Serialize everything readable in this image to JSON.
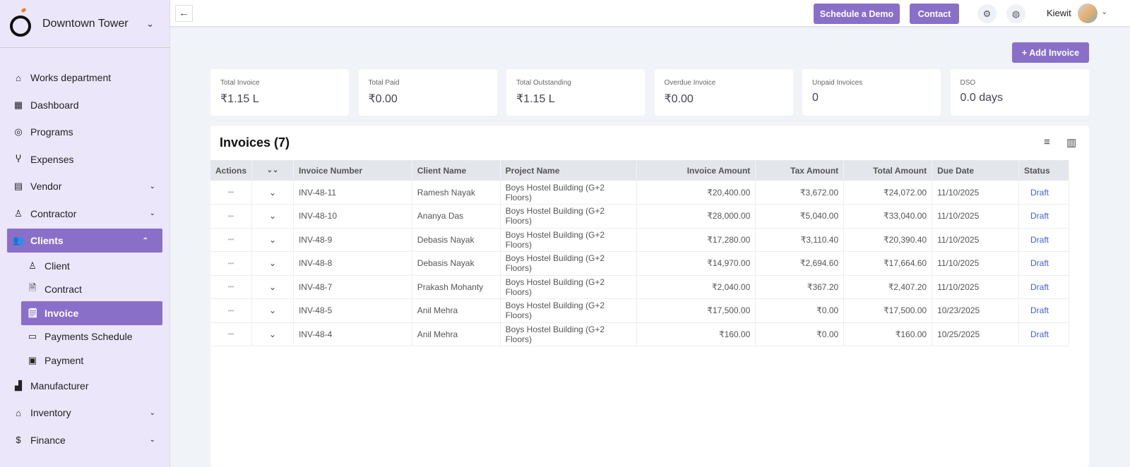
{
  "sidebar": {
    "project": "Downtown Tower",
    "items": [
      {
        "label": "Works department",
        "icon": "home-icon",
        "glyph": "⌂"
      },
      {
        "label": "Dashboard",
        "icon": "dashboard-icon",
        "glyph": "▦"
      },
      {
        "label": "Programs",
        "icon": "programs-icon",
        "glyph": "◎"
      },
      {
        "label": "Expenses",
        "icon": "expenses-icon",
        "glyph": "Ⴤ"
      },
      {
        "label": "Vendor",
        "icon": "vendor-icon",
        "glyph": "▤",
        "chev": "⌄"
      },
      {
        "label": "Contractor",
        "icon": "contractor-icon",
        "glyph": "♙",
        "chev": "⌄"
      },
      {
        "label": "Clients",
        "icon": "users-icon",
        "glyph": "👥",
        "chev": "⌃",
        "active": true,
        "children": [
          {
            "label": "Client",
            "icon": "user-icon",
            "glyph": "♙"
          },
          {
            "label": "Contract",
            "icon": "contract-icon",
            "glyph": "🗎"
          },
          {
            "label": "Invoice",
            "icon": "invoice-icon",
            "glyph": "🗒",
            "active": true
          },
          {
            "label": "Payments Schedule",
            "icon": "card-icon",
            "glyph": "▭"
          },
          {
            "label": "Payment",
            "icon": "wallet-icon",
            "glyph": "▣"
          }
        ]
      },
      {
        "label": "Manufacturer",
        "icon": "factory-icon",
        "glyph": "▟"
      },
      {
        "label": "Inventory",
        "icon": "inventory-icon",
        "glyph": "⌂",
        "chev": "⌄"
      },
      {
        "label": "Finance",
        "icon": "dollar-icon",
        "glyph": "$",
        "chev": "⌄"
      }
    ]
  },
  "topbar": {
    "schedule_demo": "Schedule a Demo",
    "contact": "Contact",
    "user": "Kiewit"
  },
  "add_invoice": "+ Add Invoice",
  "cards": [
    {
      "label": "Total Invoice",
      "value": "₹1.15 L"
    },
    {
      "label": "Total Paid",
      "value": "₹0.00"
    },
    {
      "label": "Total Outstanding",
      "value": "₹1.15 L"
    },
    {
      "label": "Overdue Invoice",
      "value": "₹0.00"
    },
    {
      "label": "Unpaid Invoices",
      "value": "0"
    },
    {
      "label": "DSO",
      "value": "0.0 days"
    }
  ],
  "table": {
    "title": "Invoices (7)",
    "columns": [
      "Actions",
      "",
      "Invoice Number",
      "Client Name",
      "Project Name",
      "Invoice Amount",
      "Tax Amount",
      "Total Amount",
      "Due Date",
      "Status"
    ],
    "rows": [
      [
        "INV-48-11",
        "Ramesh Nayak",
        "Boys Hostel Building (G+2 Floors)",
        "₹20,400.00",
        "₹3,672.00",
        "₹24,072.00",
        "11/10/2025",
        "Draft"
      ],
      [
        "INV-48-10",
        "Ananya Das",
        "Boys Hostel Building (G+2 Floors)",
        "₹28,000.00",
        "₹5,040.00",
        "₹33,040.00",
        "11/10/2025",
        "Draft"
      ],
      [
        "INV-48-9",
        "Debasis Nayak",
        "Boys Hostel Building (G+2 Floors)",
        "₹17,280.00",
        "₹3,110.40",
        "₹20,390.40",
        "11/10/2025",
        "Draft"
      ],
      [
        "INV-48-8",
        "Debasis Nayak",
        "Boys Hostel Building (G+2 Floors)",
        "₹14,970.00",
        "₹2,694.60",
        "₹17,664.60",
        "11/10/2025",
        "Draft"
      ],
      [
        "INV-48-7",
        "Prakash Mohanty",
        "Boys Hostel Building (G+2 Floors)",
        "₹2,040.00",
        "₹367.20",
        "₹2,407.20",
        "11/10/2025",
        "Draft"
      ],
      [
        "INV-48-5",
        "Anil Mehra",
        "Boys Hostel Building (G+2 Floors)",
        "₹17,500.00",
        "₹0.00",
        "₹17,500.00",
        "10/23/2025",
        "Draft"
      ],
      [
        "INV-48-4",
        "Anil Mehra",
        "Boys Hostel Building (G+2 Floors)",
        "₹160.00",
        "₹0.00",
        "₹160.00",
        "10/25/2025",
        "Draft"
      ]
    ]
  }
}
